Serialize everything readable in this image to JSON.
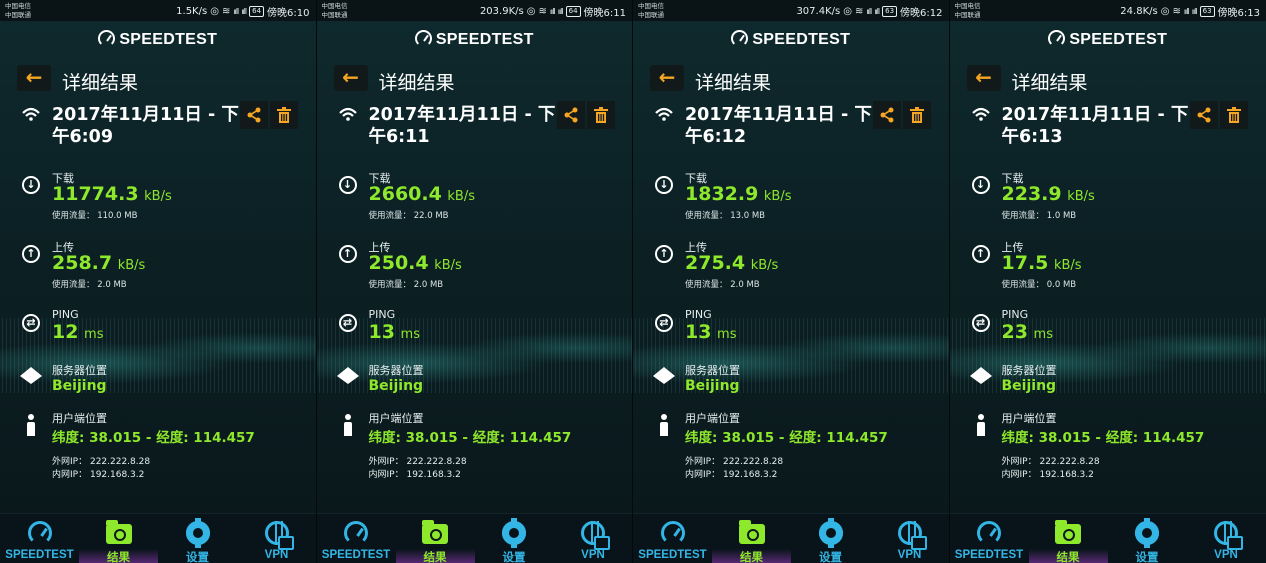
{
  "app": {
    "brand": "SPEEDTEST",
    "page_title": "详细结果",
    "labels": {
      "download": "下载",
      "upload": "上传",
      "ping": "PING",
      "usage_prefix": "使用流量：",
      "server_location": "服务器位置",
      "user_location": "用户端位置",
      "external_ip_prefix": "外网IP：",
      "internal_ip_prefix": "内网IP："
    },
    "nav": {
      "speedtest": "SPEEDTEST",
      "results": "结果",
      "settings": "设置",
      "vpn": "VPN"
    },
    "colors": {
      "accent_green": "#8ee82b",
      "accent_blue": "#33b6e5",
      "accent_orange": "#f6a623"
    }
  },
  "panels": [
    {
      "status": {
        "carrier1": "中国电信",
        "carrier2": "中国联通",
        "speed": "1.5K/s",
        "battery": "64",
        "time": "傍晚6:10"
      },
      "date": "2017年11月11日 - 下午6:09",
      "download": {
        "value": "11774.3",
        "unit": "kB/s",
        "usage": "110.0 MB"
      },
      "upload": {
        "value": "258.7",
        "unit": "kB/s",
        "usage": "2.0 MB"
      },
      "ping": {
        "value": "12",
        "unit": "ms"
      },
      "server": "Beijing",
      "coords": "纬度: 38.015 - 经度: 114.457",
      "external_ip": "222.222.8.28",
      "internal_ip": "192.168.3.2"
    },
    {
      "status": {
        "carrier1": "中国电信",
        "carrier2": "中国联通",
        "speed": "203.9K/s",
        "battery": "64",
        "time": "傍晚6:11"
      },
      "date": "2017年11月11日 - 下午6:11",
      "download": {
        "value": "2660.4",
        "unit": "kB/s",
        "usage": "22.0 MB"
      },
      "upload": {
        "value": "250.4",
        "unit": "kB/s",
        "usage": "2.0 MB"
      },
      "ping": {
        "value": "13",
        "unit": "ms"
      },
      "server": "Beijing",
      "coords": "纬度: 38.015 - 经度: 114.457",
      "external_ip": "222.222.8.28",
      "internal_ip": "192.168.3.2"
    },
    {
      "status": {
        "carrier1": "中国电信",
        "carrier2": "中国联通",
        "speed": "307.4K/s",
        "battery": "63",
        "time": "傍晚6:12"
      },
      "date": "2017年11月11日 - 下午6:12",
      "download": {
        "value": "1832.9",
        "unit": "kB/s",
        "usage": "13.0 MB"
      },
      "upload": {
        "value": "275.4",
        "unit": "kB/s",
        "usage": "2.0 MB"
      },
      "ping": {
        "value": "13",
        "unit": "ms"
      },
      "server": "Beijing",
      "coords": "纬度: 38.015 - 经度: 114.457",
      "external_ip": "222.222.8.28",
      "internal_ip": "192.168.3.2"
    },
    {
      "status": {
        "carrier1": "中国电信",
        "carrier2": "中国联通",
        "speed": "24.8K/s",
        "battery": "63",
        "time": "傍晚6:13"
      },
      "date": "2017年11月11日 - 下午6:13",
      "download": {
        "value": "223.9",
        "unit": "kB/s",
        "usage": "1.0 MB"
      },
      "upload": {
        "value": "17.5",
        "unit": "kB/s",
        "usage": "0.0 MB"
      },
      "ping": {
        "value": "23",
        "unit": "ms"
      },
      "server": "Beijing",
      "coords": "纬度: 38.015 - 经度: 114.457",
      "external_ip": "222.222.8.28",
      "internal_ip": "192.168.3.2"
    }
  ]
}
